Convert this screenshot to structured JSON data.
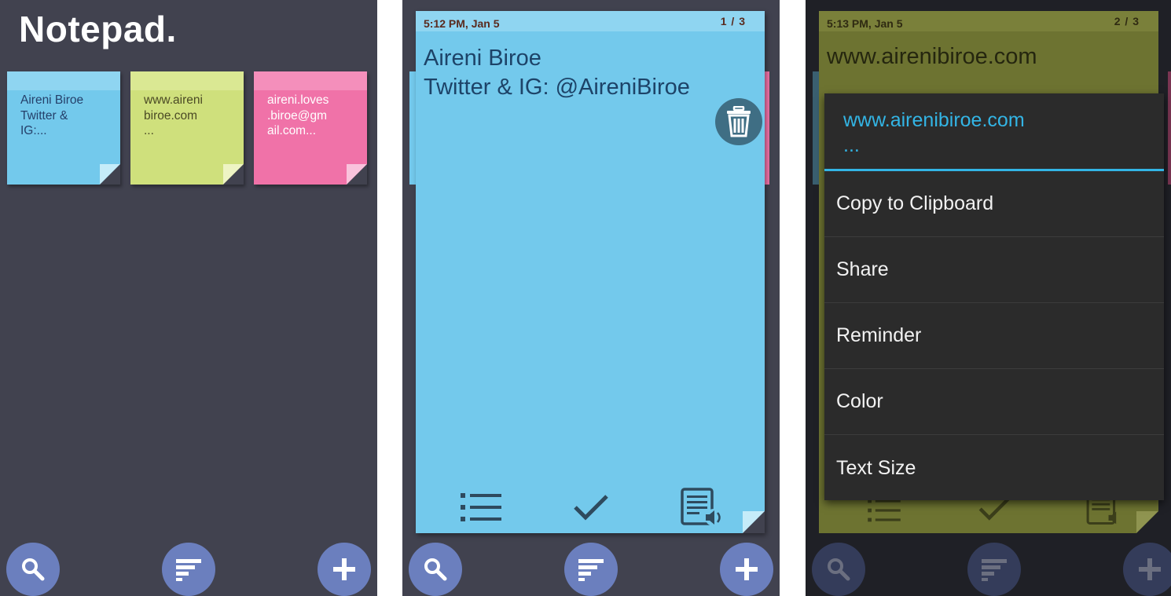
{
  "home": {
    "title": "Notepad.",
    "notes": [
      {
        "text": "Aireni Biroe\nTwitter &\nIG:...",
        "color": "#73c9ec"
      },
      {
        "text": "www.aireni\nbiroe.com\n...",
        "color": "#cfe07c"
      },
      {
        "text": "aireni.loves\n.biroe@gm\nail.com...",
        "color": "#f072a8"
      }
    ]
  },
  "detail": {
    "timestamp": "5:12 PM, Jan 5",
    "page_indicator": "1 / 3",
    "body": "Aireni Biroe\nTwitter & IG: @AireniBiroe",
    "note_color": "#73c9ec"
  },
  "context": {
    "timestamp": "5:13 PM, Jan 5",
    "page_indicator": "2 / 3",
    "body": "www.airenibiroe.com",
    "menu_title": "www.airenibiroe.com\n...",
    "menu_items": [
      "Copy to Clipboard",
      "Share",
      "Reminder",
      "Color",
      "Text Size"
    ],
    "accent": "#33b5e5"
  },
  "fabs": {
    "search": "search-icon",
    "sort": "sort-icon",
    "add": "plus-icon",
    "color": "#6b7fbe"
  }
}
